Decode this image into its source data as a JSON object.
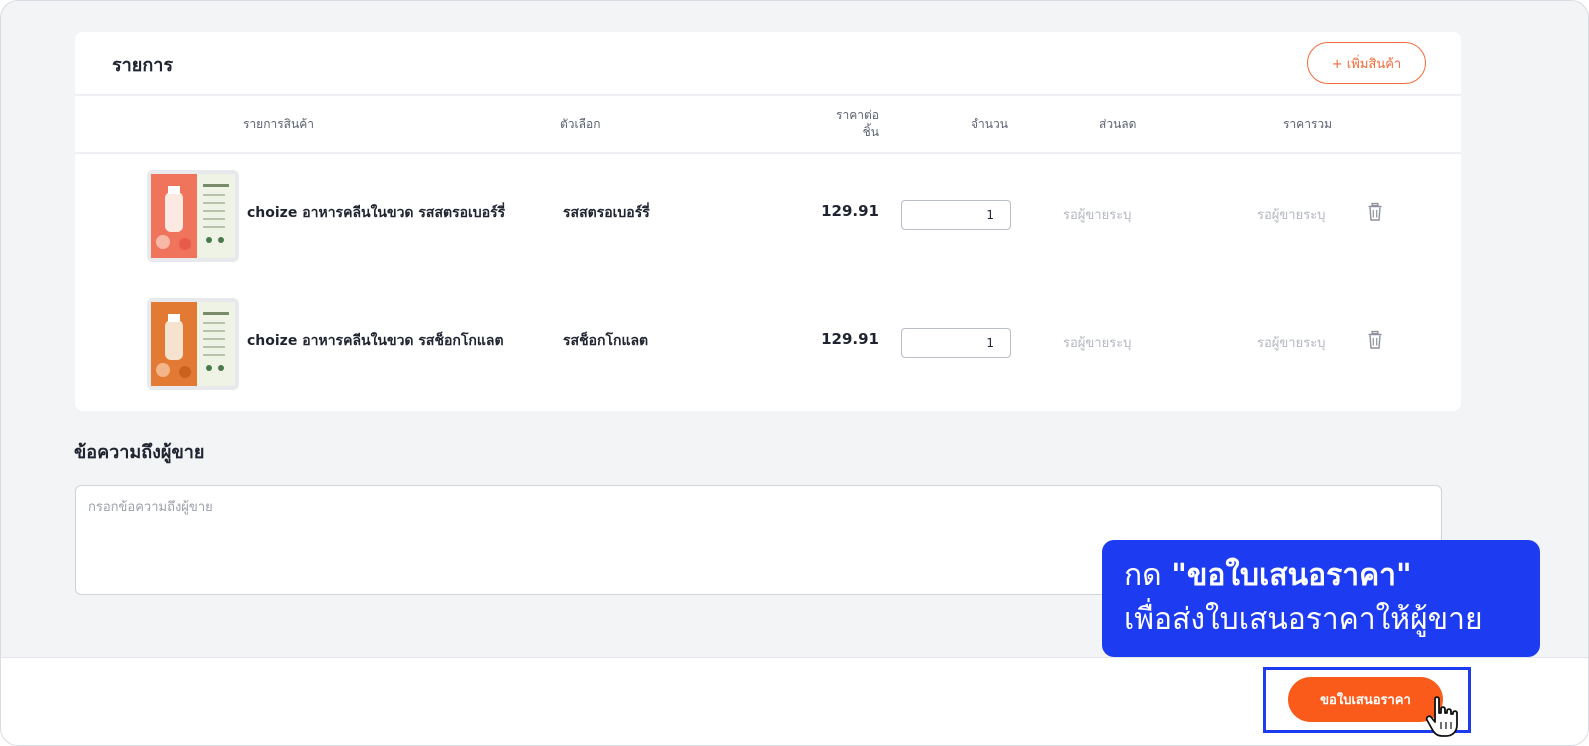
{
  "items_section": {
    "title": "รายการ",
    "add_button_label": "+ เพิ่มสินค้า",
    "columns": {
      "product": "รายการสินค้า",
      "option": "ตัวเลือก",
      "unit_price_line1": "ราคาต่อ",
      "unit_price_line2": "ชิ้น",
      "quantity": "จำนวน",
      "discount": "ส่วนลด",
      "total": "ราคารวม"
    },
    "rows": [
      {
        "name": "choize อาหารคลีนในขวด รสสตรอเบอร์รี่",
        "option": "รสสตรอเบอร์รี่",
        "unit_price": "129.91",
        "quantity": "1",
        "discount": "รอผู้ขายระบุ",
        "total": "รอผู้ขายระบุ",
        "thumb_color": "#f0735c"
      },
      {
        "name": "choize อาหารคลีนในขวด รสช็อกโกแลต",
        "option": "รสช็อกโกแลต",
        "unit_price": "129.91",
        "quantity": "1",
        "discount": "รอผู้ขายระบุ",
        "total": "รอผู้ขายระบุ",
        "thumb_color": "#e27a33"
      }
    ]
  },
  "message_section": {
    "title": "ข้อความถึงผู้ขาย",
    "placeholder": "กรอกข้อความถึงผู้ขาย",
    "value": ""
  },
  "callout": {
    "prefix": "กด ",
    "emphasis": "\"ขอใบเสนอราคา\"",
    "line2": "เพื่อส่งใบเสนอราคาให้ผู้ขาย"
  },
  "footer": {
    "submit_label": "ขอใบเสนอราคา"
  },
  "colors": {
    "accent": "#fa5a1a",
    "outline_accent": "#f26b3a",
    "callout_blue": "#1d3cf1",
    "muted_text": "#b3b7c0"
  }
}
